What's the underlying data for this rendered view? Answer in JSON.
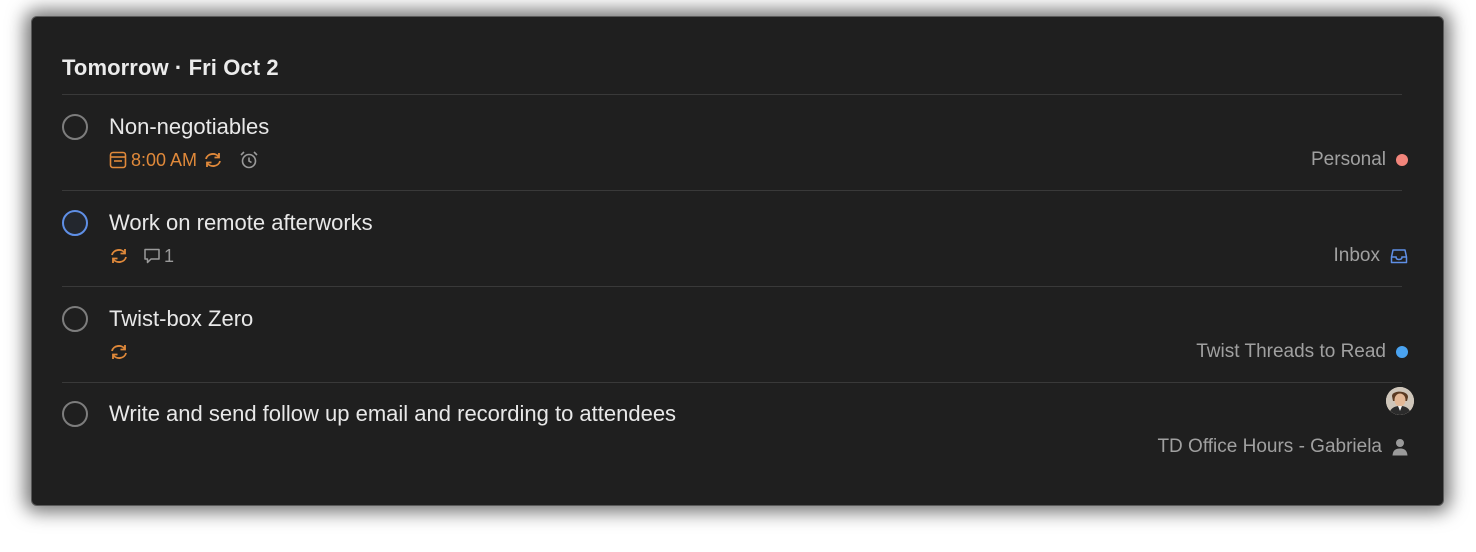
{
  "section": {
    "title": "Tomorrow · Fri Oct 2"
  },
  "tasks": [
    {
      "content": "Non-negotiables",
      "priority_color": "#7d7d7d",
      "due_time": "8:00 AM",
      "recurring": true,
      "reminder": true,
      "project": "Personal",
      "project_color": "#f2857b"
    },
    {
      "content": "Work on remote afterworks",
      "priority_color": "#5f8fe6",
      "recurring": true,
      "comment_count": "1",
      "project": "Inbox",
      "project_icon": "inbox-icon",
      "project_color": "#5f8fe6"
    },
    {
      "content": "Twist-box Zero",
      "priority_color": "#7d7d7d",
      "recurring": true,
      "project": "Twist Threads to Read",
      "project_color": "#4aa3f0"
    },
    {
      "content": "Write and send follow up email and recording to attendees",
      "priority_color": "#7d7d7d",
      "project": "TD Office Hours - Gabriela",
      "project_icon": "person-icon",
      "assignee_avatar": "avatar"
    }
  ],
  "colors": {
    "background": "#1f1f1f",
    "due_orange": "#e0893a",
    "muted_text": "#a0a0a0"
  }
}
